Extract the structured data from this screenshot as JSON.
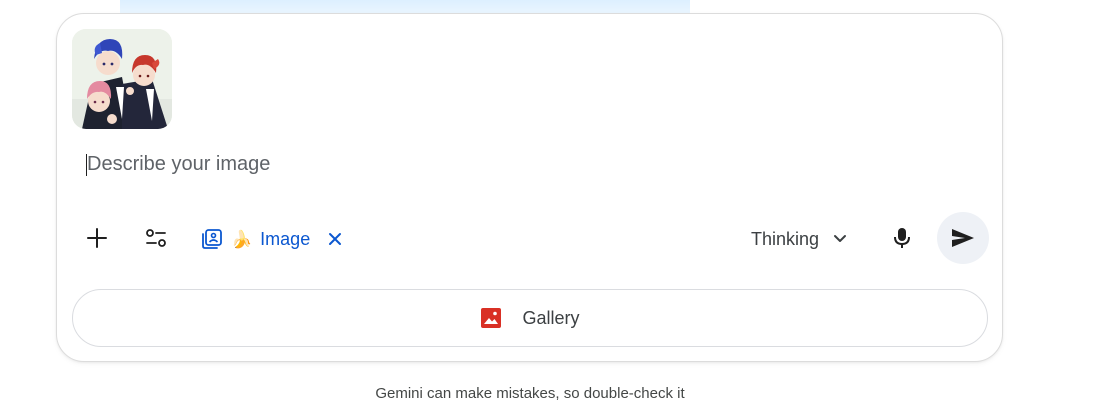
{
  "composer": {
    "thumbnail_alt": "attached anime image",
    "prompt": {
      "value": "",
      "placeholder": "Describe your image"
    }
  },
  "toolbar": {
    "add_icon": "plus-icon",
    "tools_icon": "tune-icon",
    "chip": {
      "icon": "image-gen-icon",
      "emoji": "🍌",
      "label": "Image",
      "remove_icon": "close-icon"
    },
    "mode": {
      "label": "Thinking",
      "icon": "chevron-down-icon"
    },
    "mic_icon": "mic-icon",
    "send_icon": "send-icon"
  },
  "suggestion": {
    "label": "Gallery",
    "icon": "gallery-icon",
    "icon_color": "#d93025"
  },
  "footer": {
    "disclaimer": "Gemini can make mistakes, so double-check it"
  },
  "colors": {
    "accent": "#0b57d0",
    "send_bg": "#eef1f6"
  }
}
